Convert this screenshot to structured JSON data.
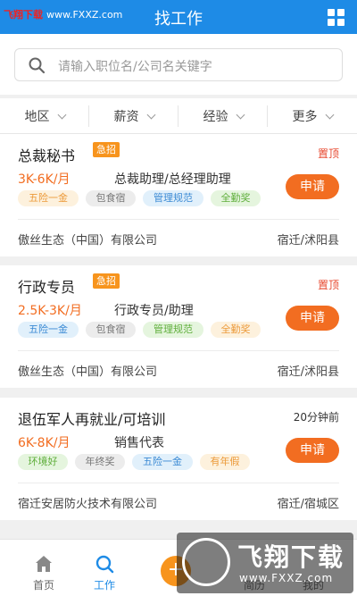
{
  "header": {
    "title": "找工作",
    "watermark": {
      "brand": "飞翔下载",
      "site": "www.FXXZ.com"
    }
  },
  "search": {
    "placeholder": "请输入职位名/公司名关键字"
  },
  "filters": [
    "地区",
    "薪资",
    "经验",
    "更多"
  ],
  "jobs": [
    {
      "title": "总裁秘书",
      "urgent": "急招",
      "flag": "置顶",
      "salary": "3K-6K/月",
      "position": "总裁助理/总经理助理",
      "tags": [
        "五险一金",
        "包食宿",
        "管理规范",
        "全勤奖"
      ],
      "apply": "申请",
      "company": "傲丝生态（中国）有限公司",
      "location": "宿迁/沭阳县"
    },
    {
      "title": "行政专员",
      "urgent": "急招",
      "flag": "置顶",
      "salary": "2.5K-3K/月",
      "position": "行政专员/助理",
      "tags": [
        "五险一金",
        "包食宿",
        "管理规范",
        "全勤奖"
      ],
      "apply": "申请",
      "company": "傲丝生态（中国）有限公司",
      "location": "宿迁/沭阳县"
    },
    {
      "title": "退伍军人再就业/可培训",
      "urgent": "",
      "flag": "20分钟前",
      "salary": "6K-8K/月",
      "position": "销售代表",
      "tags": [
        "环境好",
        "年终奖",
        "五险一金",
        "有年假"
      ],
      "apply": "申请",
      "company": "宿迁安居防火技术有限公司",
      "location": "宿迁/宿城区"
    }
  ],
  "tabs": [
    {
      "label": "首页",
      "icon": "home-icon"
    },
    {
      "label": "工作",
      "icon": "search-icon"
    },
    {
      "label": "+",
      "icon": "plus-icon"
    },
    {
      "label": "简历",
      "icon": "resume-icon"
    },
    {
      "label": "我的",
      "icon": "user-icon"
    }
  ],
  "watermark_br": {
    "brand": "飞翔下载",
    "site": "www.FXXZ.com"
  },
  "colors": {
    "primary": "#1e8be6",
    "accent": "#f26d21",
    "urgent": "#f7941d",
    "pinned": "#e7482f"
  }
}
